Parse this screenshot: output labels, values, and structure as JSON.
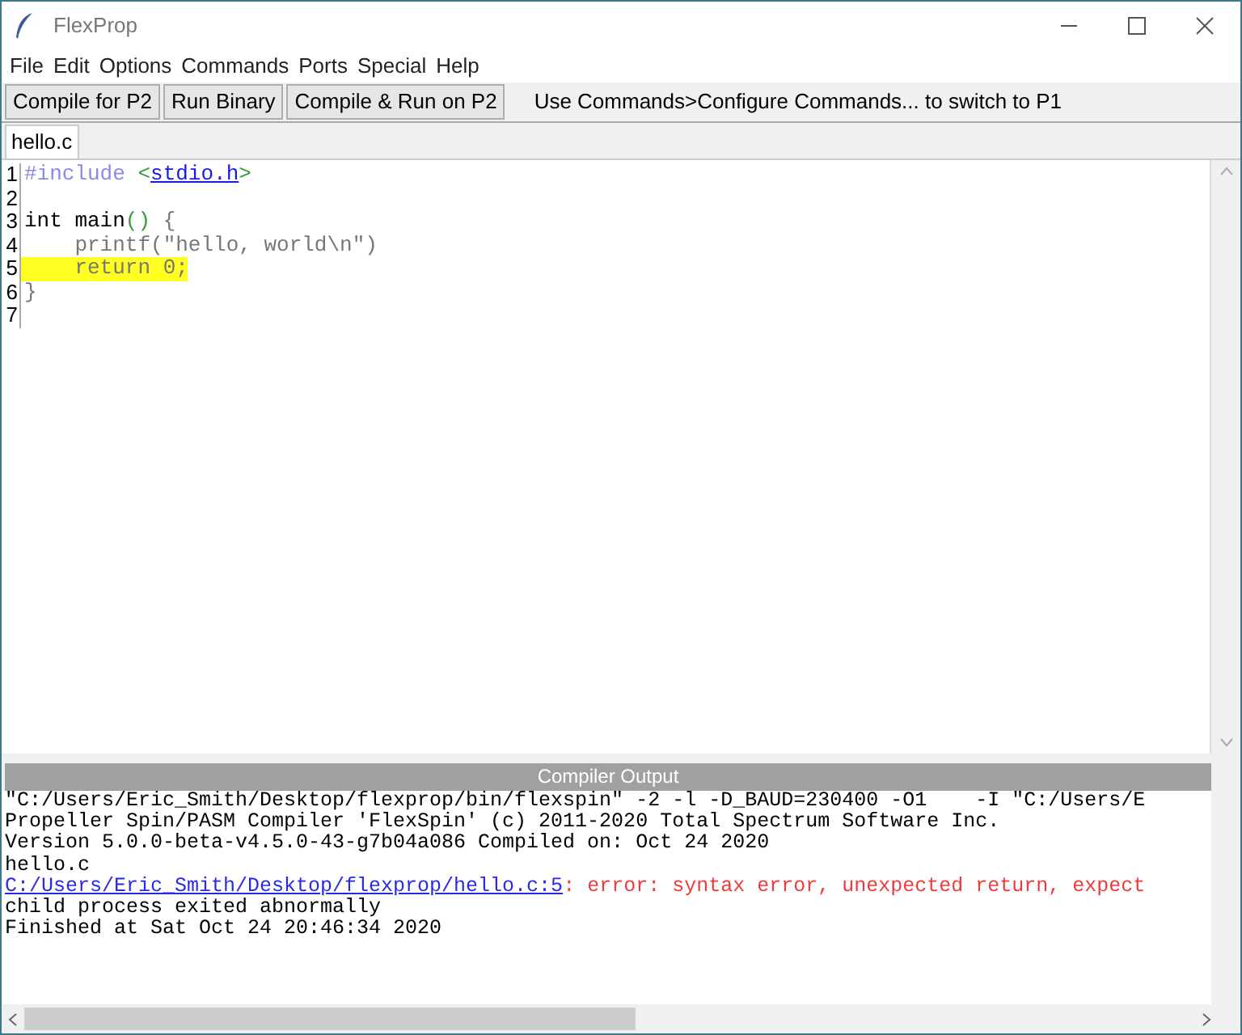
{
  "window": {
    "title": "FlexProp"
  },
  "menu": [
    "File",
    "Edit",
    "Options",
    "Commands",
    "Ports",
    "Special",
    "Help"
  ],
  "toolbar": {
    "buttons": [
      "Compile for P2",
      "Run Binary",
      "Compile & Run on P2"
    ],
    "hint": "Use Commands>Configure Commands... to switch to P1"
  },
  "tabs": [
    {
      "label": "hello.c",
      "selected": true
    }
  ],
  "editor": {
    "lines": [
      {
        "number": "1",
        "highlighted": false,
        "tokens": [
          {
            "kind": "preproc",
            "text": "#include "
          },
          {
            "kind": "bracket",
            "text": "<"
          },
          {
            "kind": "link",
            "text": "stdio.h"
          },
          {
            "kind": "bracket",
            "text": ">"
          }
        ]
      },
      {
        "number": "2",
        "highlighted": false
      },
      {
        "number": "3",
        "highlighted": false,
        "tokens": [
          {
            "kind": "plain",
            "text": "int main"
          },
          {
            "kind": "bracket",
            "text": "()"
          },
          {
            "kind": "dim",
            "text": " {"
          }
        ]
      },
      {
        "number": "4",
        "highlighted": false,
        "tokens": [
          {
            "kind": "dim",
            "text": "    printf(\"hello, world\\n\")"
          }
        ]
      },
      {
        "number": "5",
        "highlighted": true,
        "tokens": [
          {
            "kind": "dim",
            "text": "    return 0;"
          }
        ]
      },
      {
        "number": "6",
        "highlighted": false,
        "tokens": [
          {
            "kind": "dim",
            "text": "}"
          }
        ]
      },
      {
        "number": "7",
        "highlighted": false
      }
    ]
  },
  "output": {
    "title": "Compiler Output",
    "lines": [
      [
        {
          "kind": "plain",
          "text": "\"C:/Users/Eric_Smith/Desktop/flexprop/bin/flexspin\" -2 -l -D_BAUD=230400 -O1    -I \"C:/Users/E"
        }
      ],
      [
        {
          "kind": "plain",
          "text": "Propeller Spin/PASM Compiler 'FlexSpin' (c) 2011-2020 Total Spectrum Software Inc."
        }
      ],
      [
        {
          "kind": "plain",
          "text": "Version 5.0.0-beta-v4.5.0-43-g7b04a086 Compiled on: Oct 24 2020"
        }
      ],
      [
        {
          "kind": "plain",
          "text": "hello.c"
        }
      ],
      [
        {
          "kind": "link",
          "text": "C:/Users/Eric_Smith/Desktop/flexprop/hello.c:5"
        },
        {
          "kind": "error",
          "text": ": error: syntax error, unexpected return, expect"
        }
      ],
      [
        {
          "kind": "plain",
          "text": "child process exited abnormally"
        }
      ],
      [
        {
          "kind": "plain",
          "text": "Finished at Sat Oct 24 20:46:34 2020"
        }
      ]
    ]
  }
}
